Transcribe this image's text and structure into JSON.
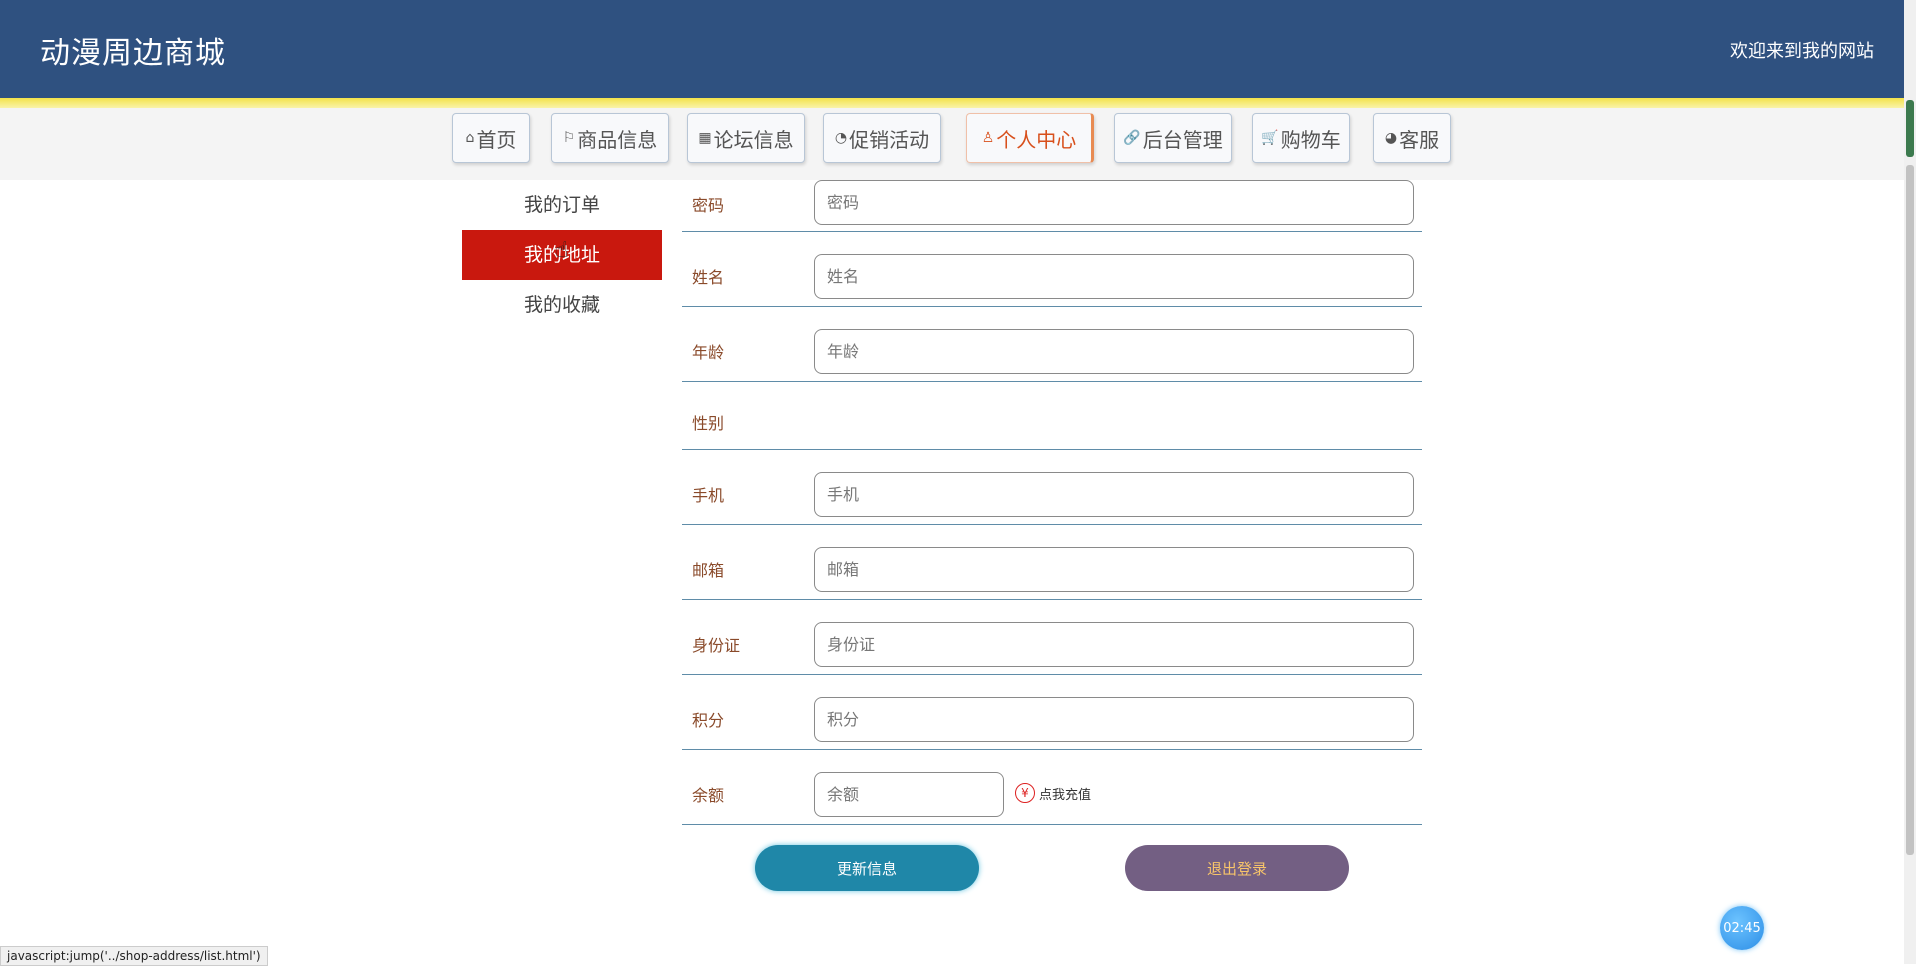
{
  "header": {
    "title": "动漫周边商城",
    "welcome": "欢迎来到我的网站"
  },
  "nav": {
    "items": [
      {
        "label": "首页",
        "icon": "⌂"
      },
      {
        "label": "商品信息",
        "icon": "⚐"
      },
      {
        "label": "论坛信息",
        "icon": "▦"
      },
      {
        "label": "促销活动",
        "icon": "◔"
      },
      {
        "label": "个人中心",
        "icon": "♙"
      },
      {
        "label": "后台管理",
        "icon": "🔗"
      },
      {
        "label": "购物车",
        "icon": "🛒"
      },
      {
        "label": "客服",
        "icon": "◕"
      }
    ]
  },
  "sidebar": {
    "items": [
      "我的订单",
      "我的地址",
      "我的收藏"
    ]
  },
  "form": {
    "password": {
      "label": "密码",
      "placeholder": "密码"
    },
    "name": {
      "label": "姓名",
      "placeholder": "姓名"
    },
    "age": {
      "label": "年龄",
      "placeholder": "年龄"
    },
    "gender": {
      "label": "性别"
    },
    "phone": {
      "label": "手机",
      "placeholder": "手机"
    },
    "email": {
      "label": "邮箱",
      "placeholder": "邮箱"
    },
    "idcard": {
      "label": "身份证",
      "placeholder": "身份证"
    },
    "points": {
      "label": "积分",
      "placeholder": "积分"
    },
    "balance": {
      "label": "余额",
      "placeholder": "余额"
    },
    "recharge_icon": "¥",
    "recharge_label": "点我充值"
  },
  "buttons": {
    "update": "更新信息",
    "logout": "退出登录"
  },
  "timer": "02:45",
  "statusbar": "javascript:jump('../shop-address/list.html')",
  "colors": {
    "header_bg": "#2f5180",
    "active_side": "#c9180e",
    "update_btn": "#1f87a8",
    "logout_btn": "#735f83"
  }
}
